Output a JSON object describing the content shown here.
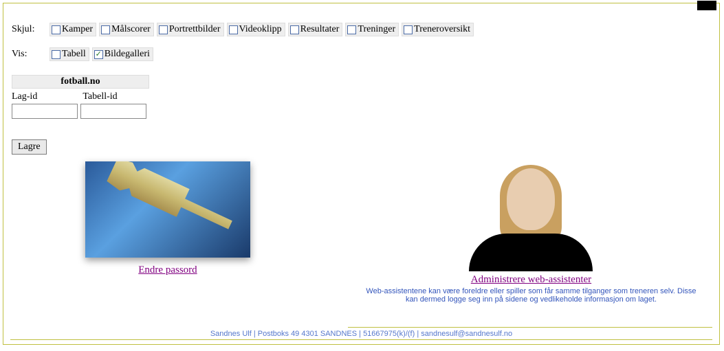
{
  "labels": {
    "skjul": "Skjul:",
    "vis": "Vis:"
  },
  "skjul_options": [
    {
      "label": "Kamper",
      "checked": false
    },
    {
      "label": "Målscorer",
      "checked": false
    },
    {
      "label": "Portrettbilder",
      "checked": false
    },
    {
      "label": "Videoklipp",
      "checked": false
    },
    {
      "label": "Resultater",
      "checked": false
    },
    {
      "label": "Treninger",
      "checked": false
    },
    {
      "label": "Treneroversikt",
      "checked": false
    }
  ],
  "vis_options": [
    {
      "label": "Tabell",
      "checked": false
    },
    {
      "label": "Bildegalleri",
      "checked": true
    }
  ],
  "fotball": {
    "header": "fotball.no",
    "lag_id_label": "Lag-id",
    "tabell_id_label": "Tabell-id",
    "lag_id_value": "",
    "tabell_id_value": ""
  },
  "save_label": "Lagre",
  "panels": {
    "password_link": "Endre passord",
    "assistants_link": "Administrere web-assistenter",
    "assistants_desc": "Web-assistentene kan være foreldre eller spiller som får samme tilganger som treneren selv. Disse kan dermed logge seg inn på sidene og vedlikeholde informasjon om laget."
  },
  "footer": {
    "org": "Sandnes Ulf",
    "address": "Postboks 49 4301 SANDNES",
    "phone": "51667975(k)/(f)",
    "email": "sandnesulf@sandnesulf.no",
    "separator": " | "
  }
}
